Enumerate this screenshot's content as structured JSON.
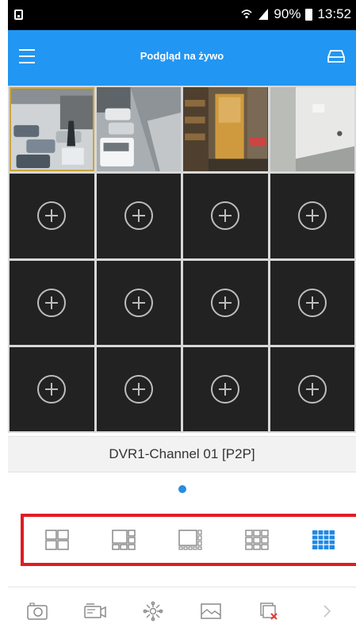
{
  "status_bar": {
    "battery": "90%",
    "time": "13:52",
    "icons": [
      "sim-card-icon",
      "wifi-icon",
      "signal-icon",
      "battery-icon"
    ]
  },
  "app_bar": {
    "title": "Podgląd na żywo",
    "left_icon": "menu-icon",
    "right_icon": "tray-icon",
    "background": "#2196f3"
  },
  "grid": {
    "columns": 4,
    "rows": 4,
    "camera_feeds": [
      {
        "position": 1,
        "selected": true
      },
      {
        "position": 2,
        "selected": false
      },
      {
        "position": 3,
        "selected": false
      },
      {
        "position": 4,
        "selected": false
      }
    ],
    "empty_slot_icon": "add-channel-icon",
    "empty_slots": 12
  },
  "channel_label": "DVR1-Channel 01 [P2P]",
  "page_indicator": {
    "pages": 1,
    "current": 1,
    "color": "#2a8be0"
  },
  "layout_options": [
    {
      "name": "layout-4-icon",
      "active": false
    },
    {
      "name": "layout-6-icon",
      "active": false
    },
    {
      "name": "layout-8-icon",
      "active": false
    },
    {
      "name": "layout-9-icon",
      "active": false
    },
    {
      "name": "layout-16-icon",
      "active": true
    }
  ],
  "toolbar": [
    {
      "name": "snapshot-icon"
    },
    {
      "name": "record-icon"
    },
    {
      "name": "ptz-icon"
    },
    {
      "name": "image-quality-icon"
    },
    {
      "name": "close-all-icon"
    },
    {
      "name": "next-icon"
    }
  ],
  "colors": {
    "highlight_border": "#e01b24",
    "active_layout": "#1e88e5",
    "selected_cell": "#c9a640"
  }
}
